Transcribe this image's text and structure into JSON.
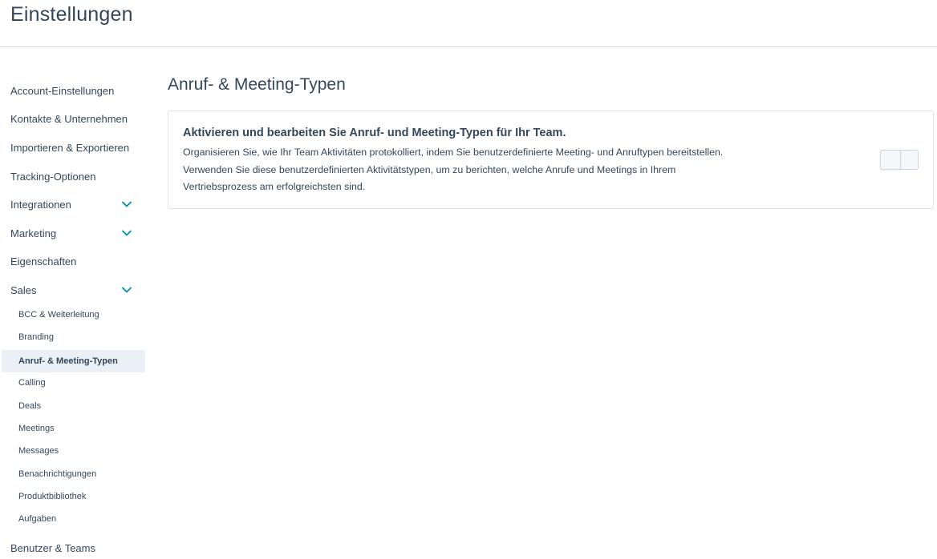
{
  "header": {
    "title": "Einstellungen"
  },
  "sidebar": {
    "items": [
      {
        "label": "Account-Einstellungen",
        "expandable": false
      },
      {
        "label": "Kontakte & Unternehmen",
        "expandable": false
      },
      {
        "label": "Importieren & Exportieren",
        "expandable": false
      },
      {
        "label": "Tracking-Optionen",
        "expandable": false
      },
      {
        "label": "Integrationen",
        "expandable": true
      },
      {
        "label": "Marketing",
        "expandable": true
      },
      {
        "label": "Eigenschaften",
        "expandable": false
      },
      {
        "label": "Sales",
        "expandable": true,
        "expanded": true
      },
      {
        "label": "Benutzer & Teams",
        "expandable": false
      }
    ],
    "sales_subitems": [
      {
        "label": "BCC & Weiterleitung"
      },
      {
        "label": "Branding"
      },
      {
        "label": "Anruf- & Meeting-Typen",
        "active": true
      },
      {
        "label": "Calling"
      },
      {
        "label": "Deals"
      },
      {
        "label": "Meetings"
      },
      {
        "label": "Messages"
      },
      {
        "label": "Benachrichtigungen"
      },
      {
        "label": "Produktbibliothek"
      },
      {
        "label": "Aufgaben"
      }
    ]
  },
  "main": {
    "title": "Anruf- & Meeting-Typen",
    "card": {
      "heading": "Aktivieren und bearbeiten Sie Anruf- und Meeting-Typen für Ihr Team.",
      "description_lines": [
        "Organisieren Sie, wie Ihr Team Aktivitäten protokolliert, indem Sie benutzerdefinierte Meeting- und Anruftypen bereitstellen.",
        "Verwenden Sie diese benutzerdefinierten Aktivitätstypen, um zu berichten, welche Anrufe und Meetings in Ihrem",
        "Vertriebsprozess am erfolgreichsten sind."
      ],
      "toggle_enabled": false
    }
  },
  "colors": {
    "text": "#33475b",
    "chevron": "#0091ae",
    "active_bg": "#eaf0f6",
    "border": "#dfe3eb"
  },
  "icons": {
    "expand": "chevron-down-icon"
  }
}
